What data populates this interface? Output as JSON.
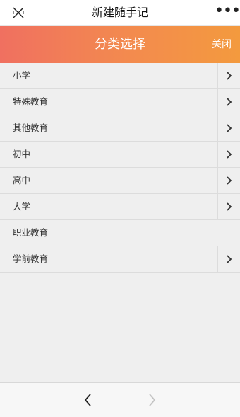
{
  "topbar": {
    "title": "新建随手记",
    "close_icon": "close-x-icon",
    "more_icon": "more-dots-icon",
    "more_glyph": "•••"
  },
  "header": {
    "title": "分类选择",
    "close_label": "关闭",
    "gradient_colors": [
      "#f07060",
      "#f39a3e"
    ]
  },
  "categories": [
    {
      "label": "小学",
      "has_chevron": true
    },
    {
      "label": "特殊教育",
      "has_chevron": true
    },
    {
      "label": "其他教育",
      "has_chevron": true
    },
    {
      "label": "初中",
      "has_chevron": true
    },
    {
      "label": "高中",
      "has_chevron": true
    },
    {
      "label": "大学",
      "has_chevron": true
    },
    {
      "label": "职业教育",
      "has_chevron": false
    },
    {
      "label": "学前教育",
      "has_chevron": true
    }
  ],
  "bottombar": {
    "back_icon": "chevron-left-icon",
    "forward_icon": "chevron-right-icon"
  }
}
